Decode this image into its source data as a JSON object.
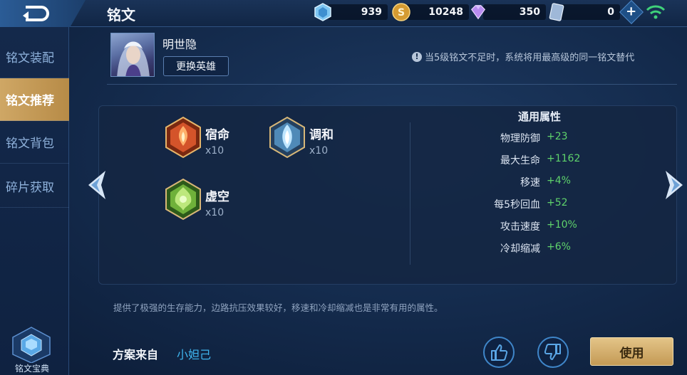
{
  "header": {
    "title": "铭文",
    "currencies": [
      {
        "name": "diamond",
        "icon": "diamond-icon",
        "value": "939"
      },
      {
        "name": "gold",
        "icon": "gold-coin-icon",
        "value": "10248"
      },
      {
        "name": "gem",
        "icon": "purple-gem-icon",
        "value": "350"
      },
      {
        "name": "ticket",
        "icon": "ticket-icon",
        "value": "0"
      }
    ]
  },
  "sidebar": {
    "items": [
      {
        "label": "铭文装配",
        "active": false
      },
      {
        "label": "铭文推荐",
        "active": true
      },
      {
        "label": "铭文背包",
        "active": false
      },
      {
        "label": "碎片获取",
        "active": false
      }
    ],
    "codex_label": "铭文宝典"
  },
  "hero": {
    "name": "明世隐",
    "swap_label": "更换英雄"
  },
  "notice": "当5级铭文不足时，系统将用最高级的同一铭文替代",
  "runes": [
    {
      "name": "宿命",
      "count": "x10",
      "color": "red"
    },
    {
      "name": "调和",
      "count": "x10",
      "color": "blue"
    },
    {
      "name": "虚空",
      "count": "x10",
      "color": "green"
    }
  ],
  "attributes": {
    "title": "通用属性",
    "rows": [
      {
        "name": "物理防御",
        "value": "+23"
      },
      {
        "name": "最大生命",
        "value": "+1162"
      },
      {
        "name": "移速",
        "value": "+4%"
      },
      {
        "name": "每5秒回血",
        "value": "+52"
      },
      {
        "name": "攻击速度",
        "value": "+10%"
      },
      {
        "name": "冷却缩减",
        "value": "+6%"
      }
    ]
  },
  "description": "提供了极强的生存能力，边路抗压效果较好，移速和冷却缩减也是非常有用的属性。",
  "source": {
    "label": "方案来自",
    "author": "小妲己"
  },
  "actions": {
    "use_label": "使用"
  },
  "colors": {
    "accent_gold": "#cfa765",
    "value_green": "#5fd36b",
    "author_blue": "#3fb6f0"
  }
}
